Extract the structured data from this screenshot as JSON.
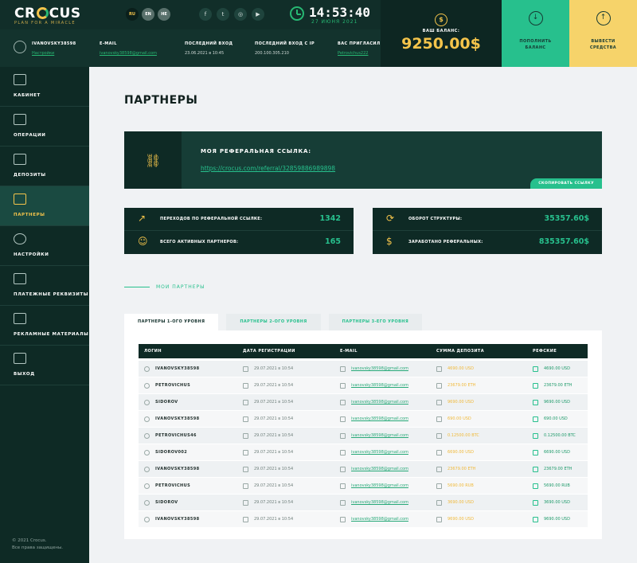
{
  "header": {
    "logo": {
      "text_pre": "CR",
      "text_post": "CUS",
      "tagline": "PLAN FOR A MIRACLE"
    },
    "languages": [
      {
        "code": "RU",
        "active": true
      },
      {
        "code": "EN",
        "active": false
      },
      {
        "code": "HE",
        "active": false
      }
    ],
    "socials": [
      {
        "name": "facebook-icon",
        "glyph": "f"
      },
      {
        "name": "twitter-icon",
        "glyph": "t"
      },
      {
        "name": "instagram-icon",
        "glyph": "◎"
      },
      {
        "name": "youtube-icon",
        "glyph": "▶"
      }
    ],
    "time": "14:53:40",
    "date": "27 ИЮНЯ 2021",
    "user": {
      "login": "IVANOVSKY38598",
      "settings_link": "Настройки"
    },
    "fields": [
      {
        "label": "E-MAIL",
        "value": "ivanovsky38598@gmail.com",
        "link": true
      },
      {
        "label": "ПОСЛЕДНИЙ ВХОД",
        "value": "23.06.2021 в 10:45",
        "link": false
      },
      {
        "label": "ПОСЛЕДНИЙ ВХОД С IP",
        "value": "200.100.305.210",
        "link": false
      },
      {
        "label": "ВАС ПРИГЛАСИЛ",
        "value": "Petrovichus222",
        "link": true
      }
    ],
    "balance": {
      "label": "ВАШ БАЛАНС:",
      "value": "9250.00$"
    },
    "deposit": {
      "label_1": "ПОПОЛНИТЬ",
      "label_2": "БАЛАНС"
    },
    "withdraw": {
      "label_1": "ВЫВЕСТИ",
      "label_2": "СРЕДСТВА"
    },
    "colors": {
      "accent_green": "#27c08d",
      "accent_yellow": "#f4c44b",
      "dark": "#0e2a25"
    }
  },
  "sidebar": {
    "items": [
      {
        "id": "cabinet",
        "label": "КАБИНЕТ",
        "icon": "bars-icon",
        "active": false
      },
      {
        "id": "operations",
        "label": "ОПЕРАЦИИ",
        "icon": "calendar-icon",
        "active": false
      },
      {
        "id": "deposits",
        "label": "ДЕПОЗИТЫ",
        "icon": "document-icon",
        "active": false
      },
      {
        "id": "partners",
        "label": "ПАРТНЕРЫ",
        "icon": "people-icon",
        "active": true
      },
      {
        "id": "settings",
        "label": "НАСТРОЙКИ",
        "icon": "gear-icon",
        "active": false
      },
      {
        "id": "payment",
        "label": "ПЛАТЕЖНЫЕ РЕКВИЗИТЫ",
        "icon": "wallet-icon",
        "active": false
      },
      {
        "id": "promo",
        "label": "РЕКЛАМНЫЕ МАТЕРИАЛЫ",
        "icon": "promo-icon",
        "active": false
      },
      {
        "id": "logout",
        "label": "ВЫХОД",
        "icon": "logout-icon",
        "active": false
      }
    ],
    "copyright_1": "© 2021 Crocus.",
    "copyright_2": "Все права защищены."
  },
  "main": {
    "title": "ПАРТНЕРЫ",
    "referral": {
      "title": "МОЯ РЕФЕРАЛЬНАЯ ССЫЛКА:",
      "link": "https://crocus.com/referral/32859886989898",
      "copy_button": "СКОПИРОВАТЬ ССЫЛКУ"
    },
    "stats_left": [
      {
        "label": "ПЕРЕХОДОВ ПО РЕФЕРАЛЬНОЙ ССЫЛКЕ:",
        "value": "1342",
        "icon": "external-link-icon",
        "glyph": "↗"
      },
      {
        "label": "ВСЕГО АКТИВНЫХ ПАРТНЕРОВ:",
        "value": "165",
        "icon": "people-icon",
        "glyph": "☺"
      }
    ],
    "stats_right": [
      {
        "label": "ОБОРОТ СТРУКТУРЫ:",
        "value": "35357.60$",
        "icon": "refresh-icon",
        "glyph": "⟳"
      },
      {
        "label": "ЗАРАБОТАНО РЕФЕРАЛЬНЫХ:",
        "value": "835357.60$",
        "icon": "coin-icon",
        "glyph": "$"
      }
    ],
    "section_title": "МОИ ПАРТНЕРЫ",
    "tabs": [
      {
        "label": "ПАРТНЕРЫ 1-ОГО УРОВНЯ",
        "active": true
      },
      {
        "label": "ПАРТНЕРЫ 2-ОГО УРОВНЯ",
        "active": false
      },
      {
        "label": "ПАРТНЕРЫ 3-ЕГО УРОВНЯ",
        "active": false
      }
    ],
    "table": {
      "columns": [
        "ЛОГИН",
        "ДАТА РЕГИСТРАЦИИ",
        "E-MAIL",
        "СУММА ДЕПОЗИТА",
        "РЕФСКИЕ"
      ],
      "rows": [
        {
          "login": "IVANOVSKY38598",
          "reg": "29.07.2021 в 10:54",
          "email": "ivanovsky38598@gmail.com",
          "sum": "4690.00 USD",
          "ref": "4690.00 USD"
        },
        {
          "login": "PETROVICHUS",
          "reg": "29.07.2021 в 10:54",
          "email": "ivanovsky38598@gmail.com",
          "sum": "23679.00 ETH",
          "ref": "23679.00 ETH"
        },
        {
          "login": "SIDOROV",
          "reg": "29.07.2021 в 10:54",
          "email": "ivanovsky38598@gmail.com",
          "sum": "9690.00 USD",
          "ref": "9690.00 USD"
        },
        {
          "login": "IVANOVSKY38598",
          "reg": "29.07.2021 в 10:54",
          "email": "ivanovsky38598@gmail.com",
          "sum": "690.00 USD",
          "ref": "690.00 USD"
        },
        {
          "login": "PETROVICHUS46",
          "reg": "29.07.2021 в 10:54",
          "email": "ivanovsky38598@gmail.com",
          "sum": "0.12500.00 BTC",
          "ref": "0.12500.00 BTC"
        },
        {
          "login": "SIDOROV002",
          "reg": "29.07.2021 в 10:54",
          "email": "ivanovsky38598@gmail.com",
          "sum": "6690.00 USD",
          "ref": "6690.00 USD"
        },
        {
          "login": "IVANOVSKY38598",
          "reg": "29.07.2021 в 10:54",
          "email": "ivanovsky38598@gmail.com",
          "sum": "23679.00 ETH",
          "ref": "23679.00 ETH"
        },
        {
          "login": "PETROVICHUS",
          "reg": "29.07.2021 в 10:54",
          "email": "ivanovsky38598@gmail.com",
          "sum": "5690.00 RUB",
          "ref": "5690.00 RUB"
        },
        {
          "login": "SIDOROV",
          "reg": "29.07.2021 в 10:54",
          "email": "ivanovsky38598@gmail.com",
          "sum": "3690.00 USD",
          "ref": "3690.00 USD"
        },
        {
          "login": "IVANOVSKY38598",
          "reg": "29.07.2021 в 10:54",
          "email": "ivanovsky38598@gmail.com",
          "sum": "9690.00 USD",
          "ref": "9690.00 USD"
        }
      ]
    }
  }
}
